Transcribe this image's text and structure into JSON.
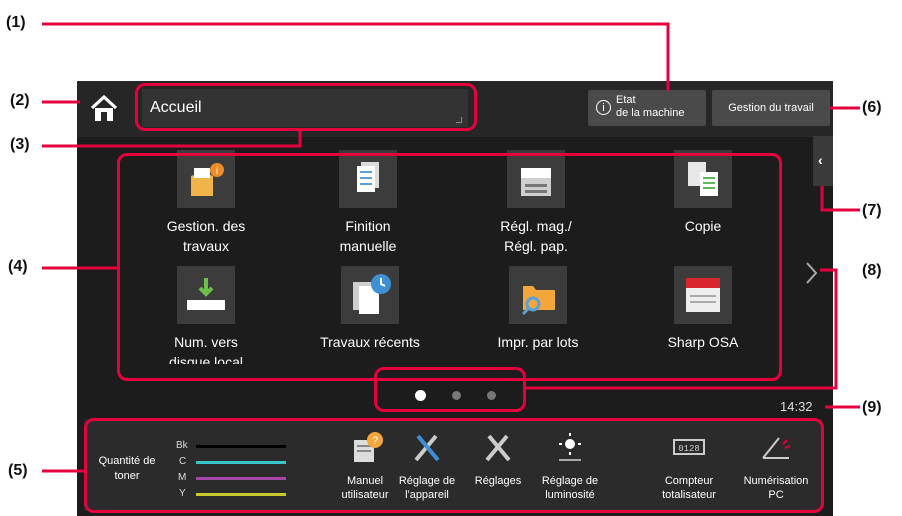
{
  "callouts": [
    "(1)",
    "(2)",
    "(3)",
    "(4)",
    "(5)",
    "(6)",
    "(7)",
    "(8)",
    "(9)"
  ],
  "header": {
    "breadcrumb": "Accueil",
    "status_button": {
      "line1": "Etat",
      "line2": "de la machine"
    },
    "jobs_button": "Gestion du travail"
  },
  "tiles": [
    {
      "line1": "Gestion. des",
      "line2": "travaux",
      "icon": "job-status-icon"
    },
    {
      "line1": "Finition",
      "line2": "manuelle",
      "icon": "manual-finishing-icon"
    },
    {
      "line1": "Régl. mag./",
      "line2": "Régl. pap.",
      "icon": "tray-settings-icon"
    },
    {
      "line1": "Copie",
      "line2": "",
      "icon": "copy-icon"
    },
    {
      "line1": "Num. vers",
      "line2": "disque local",
      "icon": "scan-to-local-drive-icon"
    },
    {
      "line1": "Travaux récents",
      "line2": "",
      "icon": "recent-jobs-icon"
    },
    {
      "line1": "Impr. par lots",
      "line2": "",
      "icon": "batch-print-icon"
    },
    {
      "line1": "Sharp OSA",
      "line2": "",
      "icon": "sharp-osa-icon"
    }
  ],
  "pagination": {
    "pages": 3,
    "current": 1
  },
  "time": "14:32",
  "toner": {
    "title_line1": "Quantité de",
    "title_line2": "toner",
    "colors": [
      {
        "label": "Bk",
        "color": "#000000",
        "level": 1.0
      },
      {
        "label": "C",
        "color": "#36c5c9",
        "level": 1.0
      },
      {
        "label": "M",
        "color": "#a545a6",
        "level": 1.0
      },
      {
        "label": "Y",
        "color": "#c7c92c",
        "level": 1.0
      }
    ]
  },
  "quick_keys": [
    {
      "line1": "Manuel",
      "line2": "utilisateur",
      "icon": "user-manual-icon"
    },
    {
      "line1": "Réglage de",
      "line2": "l'appareil",
      "icon": "device-settings-icon"
    },
    {
      "line1": "Réglages",
      "line2": "",
      "icon": "settings-icon"
    },
    {
      "line1": "Réglage de",
      "line2": "luminosité",
      "icon": "brightness-icon"
    },
    {
      "line1": "Compteur",
      "line2": "totalisateur",
      "icon": "counter-icon"
    },
    {
      "line1": "Numérisation",
      "line2": "PC",
      "icon": "pc-scan-icon"
    }
  ],
  "colors": {
    "accent": "#e5003e",
    "screen": "#1c1c1c"
  }
}
